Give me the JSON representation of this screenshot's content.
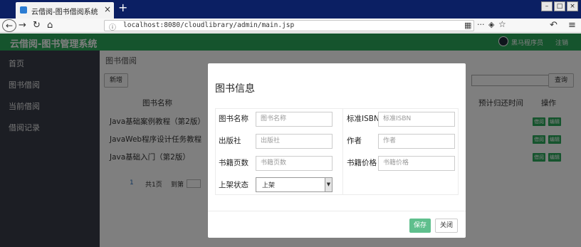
{
  "browser": {
    "tab_title": "云借阅-图书借阅系统",
    "tab_close": "×",
    "new_tab": "+",
    "url": "localhost:8080/cloudlibrary/admin/main.jsp",
    "win_min": "–",
    "win_max": "□",
    "win_close": "×"
  },
  "header": {
    "title": "云借阅-图书管理系统",
    "user_name": "黑马程序员",
    "user_menu": "注销"
  },
  "sidebar": {
    "items": [
      {
        "label": "首页"
      },
      {
        "label": "图书借阅"
      },
      {
        "label": "当前借阅"
      },
      {
        "label": "借阅记录"
      }
    ]
  },
  "main": {
    "breadcrumb": "图书借阅",
    "add_label": "新增",
    "search_label": "查询",
    "columns": {
      "name": "图书名称",
      "return_time": "预计归还时间",
      "actions": "操作"
    },
    "rows": [
      {
        "title": "Java基础案例教程（第2版）",
        "action1": "借阅",
        "action2": "编辑"
      },
      {
        "title": "JavaWeb程序设计任务教程",
        "action1": "借阅",
        "action2": "编辑"
      },
      {
        "title": "Java基础入门（第2版）",
        "action1": "借阅",
        "action2": "编辑"
      }
    ],
    "pager": {
      "current": "1",
      "total": "共1页",
      "goto": "到第"
    }
  },
  "modal": {
    "title": "图书信息",
    "fields": {
      "name_label": "图书名称",
      "name_placeholder": "图书名称",
      "isbn_label": "标准ISBN",
      "isbn_placeholder": "标准ISBN",
      "press_label": "出版社",
      "press_placeholder": "出版社",
      "author_label": "作者",
      "author_placeholder": "作者",
      "pages_label": "书籍页数",
      "pages_placeholder": "书籍页数",
      "price_label": "书籍价格",
      "price_placeholder": "书籍价格",
      "status_label": "上架状态",
      "status_value": "上架"
    },
    "save_label": "保存",
    "close_label": "关闭"
  },
  "colors": {
    "brand_green": "#2aa85a",
    "sidebar_bg": "#393d49",
    "titlebar_bg": "#0b1f63"
  }
}
